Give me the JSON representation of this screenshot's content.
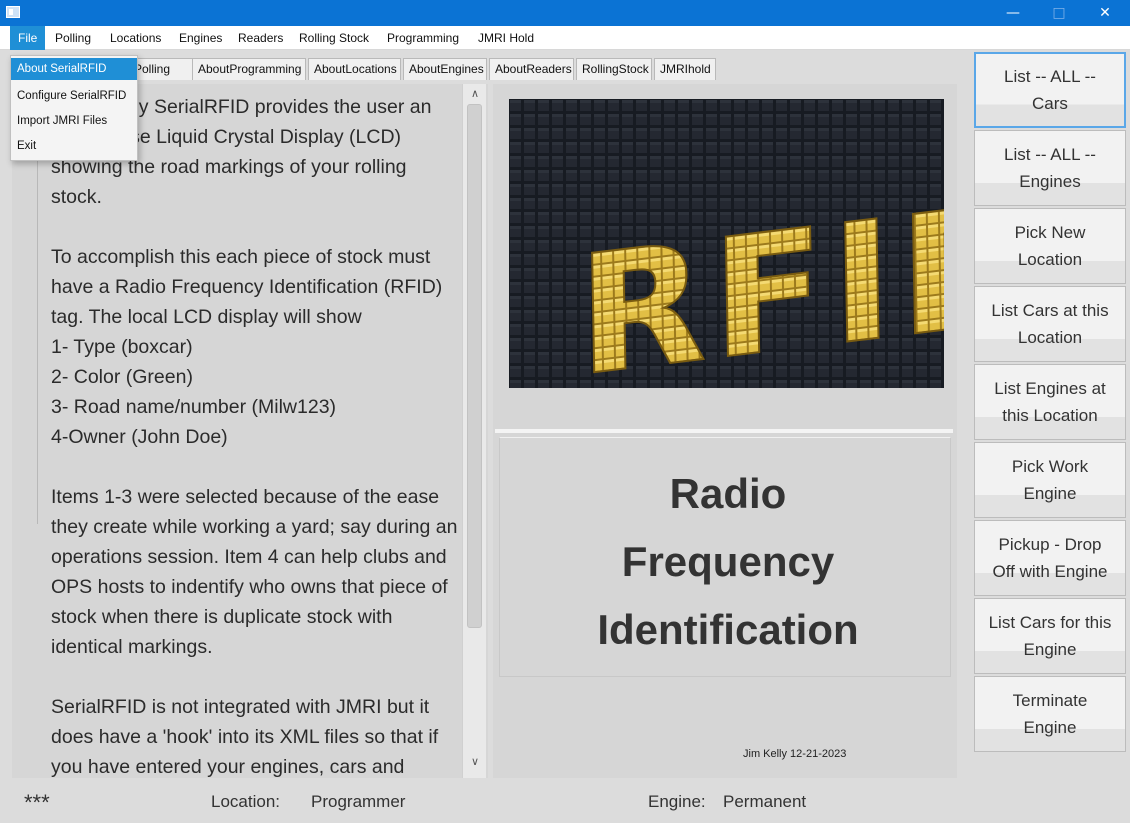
{
  "window": {
    "min_glyph": "—",
    "max_glyph": "□",
    "close_glyph": "✕"
  },
  "menu": [
    "File",
    "Polling",
    "Locations",
    "Engines",
    "Readers",
    "Rolling Stock",
    "Programming",
    "JMRI Hold"
  ],
  "file_menu": [
    "About SerialRFID",
    "Configure SerialRFID",
    "Import JMRI Files",
    "Exit"
  ],
  "tabs": [
    "utPolling",
    "AboutProgramming",
    "AboutLocations",
    "AboutEngines",
    "AboutReaders",
    "RollingStock",
    "JMRIhold"
  ],
  "about_text": "Incidentally SerialRFID provides the user an easy to use Liquid Crystal Display (LCD) showing the road markings of your rolling stock.\n\nTo accomplish this each piece of stock must have a Radio Frequency Identification (RFID) tag. The local LCD display will show\n1- Type (boxcar)\n2- Color (Green)\n3- Road name/number (Milw123)\n4-Owner (John Doe)\n\nItems 1-3 were selected because of the ease they create while working a yard; say during an operations session. Item 4 can help clubs and OPS hosts to indentify who owns that piece of stock when there is duplicate stock with identical markings.\n\nSerialRFID is not integrated with JMRI but it does have a 'hook' into its XML files so that if you have entered your engines, cars and",
  "scroll": {
    "up": "∧",
    "down": "∨"
  },
  "image": {
    "text": "RFID"
  },
  "title_lines": [
    "Radio",
    "Frequency",
    "Identification"
  ],
  "author": "Jim Kelly 12-21-2023",
  "buttons": [
    "List -- ALL --\nCars",
    "List -- ALL --\nEngines",
    "Pick New\nLocation",
    "List Cars at this\nLocation",
    "List Engines at\nthis Location",
    "Pick Work\nEngine",
    "Pickup - Drop\nOff with Engine",
    "List Cars for this\nEngine",
    "Terminate\nEngine"
  ],
  "status": {
    "stars": "***",
    "location_label": "Location:",
    "location_value": "Programmer",
    "engine_label": "Engine:",
    "engine_value": "Permanent"
  },
  "colors": {
    "titlebar": "#0b73d4",
    "menu_highlight": "#1f8fd6",
    "rfid_letters": "#e8c547"
  }
}
